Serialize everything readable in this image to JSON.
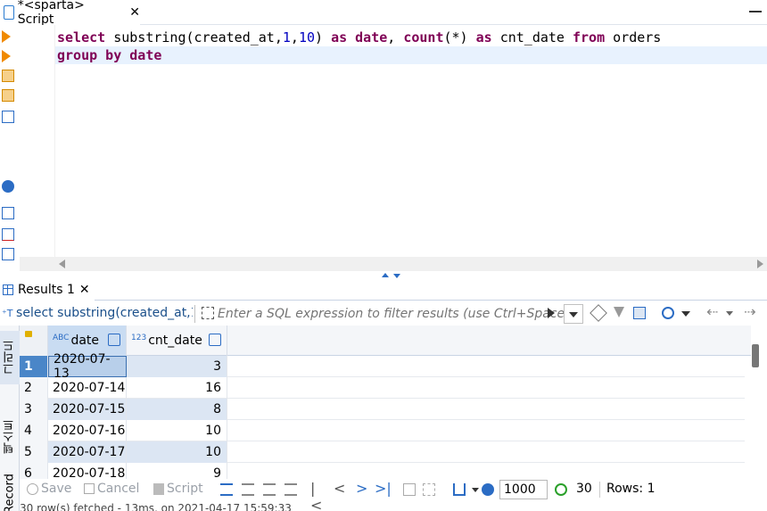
{
  "editor_tab": {
    "title": "*<sparta> Script",
    "close": "✕"
  },
  "code": {
    "line1": [
      {
        "t": "select",
        "c": "kw"
      },
      {
        "t": " substring(created_at,",
        "c": "fn"
      },
      {
        "t": "1",
        "c": "num"
      },
      {
        "t": ",",
        "c": "fn"
      },
      {
        "t": "10",
        "c": "num"
      },
      {
        "t": ") ",
        "c": "fn"
      },
      {
        "t": "as",
        "c": "kw"
      },
      {
        "t": " ",
        "c": "fn"
      },
      {
        "t": "date",
        "c": "kw"
      },
      {
        "t": ", ",
        "c": "fn"
      },
      {
        "t": "count",
        "c": "kw"
      },
      {
        "t": "(*) ",
        "c": "fn"
      },
      {
        "t": "as",
        "c": "kw"
      },
      {
        "t": " cnt_date ",
        "c": "fn"
      },
      {
        "t": "from",
        "c": "kw"
      },
      {
        "t": " orders",
        "c": "fn"
      }
    ],
    "line2": [
      {
        "t": "group by date",
        "c": "kw"
      }
    ]
  },
  "results_tab": {
    "title": "Results 1",
    "close": "✕"
  },
  "filter": {
    "query_label": "select substring(created_at,1,",
    "placeholder": "Enter a SQL expression to filter results (use Ctrl+Space)"
  },
  "side_tabs": {
    "grid": "그리드",
    "text": "텍스트",
    "record": "Record"
  },
  "grid": {
    "columns": [
      {
        "type": "ABC",
        "name": "date"
      },
      {
        "type": "123",
        "name": "cnt_date"
      }
    ],
    "rows": [
      {
        "n": "1",
        "date": "2020-07-13",
        "cnt": "3"
      },
      {
        "n": "2",
        "date": "2020-07-14",
        "cnt": "16"
      },
      {
        "n": "3",
        "date": "2020-07-15",
        "cnt": "8"
      },
      {
        "n": "4",
        "date": "2020-07-16",
        "cnt": "10"
      },
      {
        "n": "5",
        "date": "2020-07-17",
        "cnt": "10"
      },
      {
        "n": "6",
        "date": "2020-07-18",
        "cnt": "9"
      }
    ]
  },
  "bottombar": {
    "save": "Save",
    "cancel": "Cancel",
    "script": "Script",
    "fetch_size": "1000",
    "refresh_count": "30",
    "rows": "Rows: 1"
  },
  "statusbar": {
    "text": "30 row(s) fetched - 13ms, on 2021-04-17 15:59:33"
  },
  "colors": {
    "accent": "#2b6cc4",
    "keyword": "#7f0055",
    "number": "#0000c0",
    "run": "#f08a00",
    "refresh": "#2aa02a"
  }
}
